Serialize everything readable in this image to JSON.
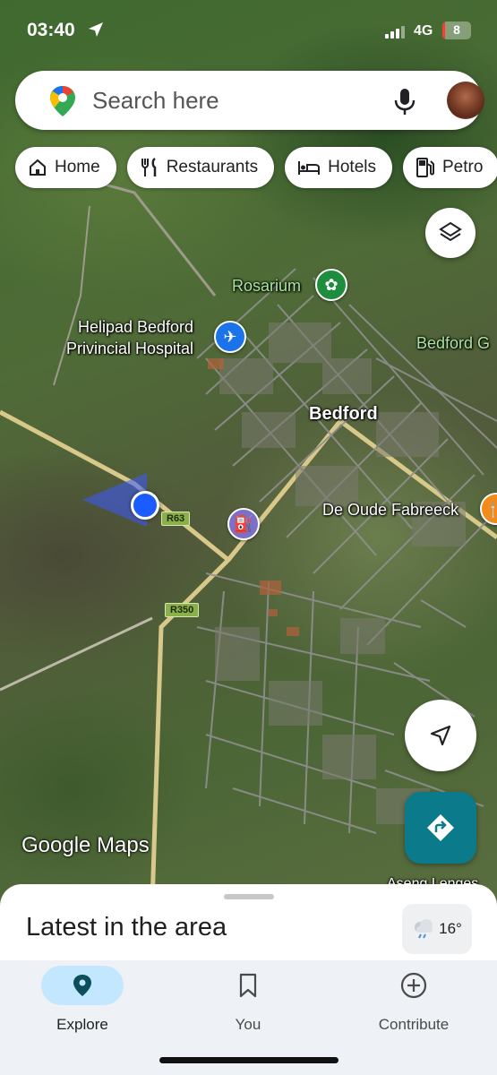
{
  "status_bar": {
    "time": "03:40",
    "network": "4G",
    "battery": "8",
    "battery_level": 0.08
  },
  "search": {
    "placeholder": "Search here",
    "icons": [
      "google-maps-pin-icon",
      "microphone-icon",
      "avatar"
    ]
  },
  "chips": [
    {
      "label": "Home",
      "icon": "home-icon"
    },
    {
      "label": "Restaurants",
      "icon": "fork-knife-icon"
    },
    {
      "label": "Hotels",
      "icon": "bed-icon"
    },
    {
      "label": "Petro",
      "icon": "fuel-icon"
    }
  ],
  "map": {
    "places": {
      "rosarium": "Rosarium",
      "helipad_line1": "Helipad Bedford",
      "helipad_line2": "Privincial Hospital",
      "bedford_g": "Bedford G",
      "bedford": "Bedford",
      "de_oude": "De Oude Fabreeck",
      "aseng": "Aseng Lenges"
    },
    "roads": {
      "r63": "R63",
      "r350": "R350"
    },
    "logo": "Google Maps",
    "colors": {
      "garden_pin": "#1e8e3e",
      "airport_pin": "#1a73e8",
      "fuel_pin": "#7b6fc8",
      "restaurant_pin": "#f28b1c",
      "location_dot": "#1a5cff"
    }
  },
  "sheet": {
    "title": "Latest in the area",
    "temperature": "16°"
  },
  "nav": [
    {
      "label": "Explore",
      "icon": "location-pin-icon",
      "active": true
    },
    {
      "label": "You",
      "icon": "bookmark-icon",
      "active": false
    },
    {
      "label": "Contribute",
      "icon": "plus-circle-icon",
      "active": false
    }
  ]
}
